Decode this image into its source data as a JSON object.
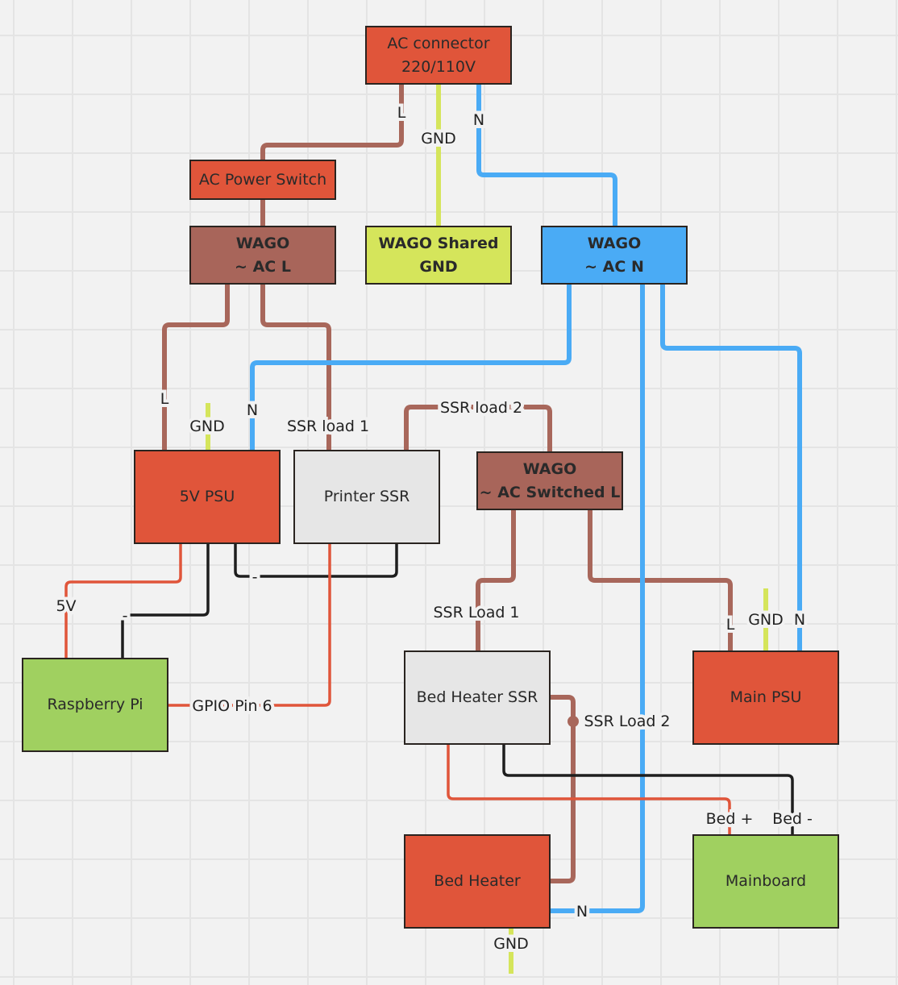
{
  "colors": {
    "red": "#e0553a",
    "brown": "#a8675b",
    "yellow": "#d5e55b",
    "blue": "#4aabf5",
    "green": "#a0d060",
    "grey": "#e6e6e6",
    "black": "#1e1e1e"
  },
  "nodes": {
    "ac_connector": "AC connector\n220/110V",
    "ac_power_switch": "AC Power Switch",
    "wago_ac_l": "WAGO\n~ AC L",
    "wago_shared_gnd": "WAGO Shared\nGND",
    "wago_ac_n": "WAGO\n~ AC N",
    "psu_5v": "5V PSU",
    "printer_ssr": "Printer SSR",
    "wago_switched_l": "WAGO\n~ AC Switched L",
    "raspberry_pi": "Raspberry Pi",
    "bed_heater_ssr": "Bed Heater SSR",
    "main_psu": "Main PSU",
    "bed_heater": "Bed Heater",
    "mainboard": "Mainboard"
  },
  "wire_labels": {
    "ac_l": "L",
    "ac_gnd": "GND",
    "ac_n": "N",
    "psu5_l": "L",
    "psu5_gnd": "GND",
    "psu5_n": "N",
    "ssr_load1": "SSR load 1",
    "ssr_load2": "SSR load 2",
    "bed_ssr_load1": "SSR Load 1",
    "bed_ssr_load2": "SSR Load 2",
    "main_l": "L",
    "main_gnd": "GND",
    "main_n": "N",
    "rpi_5v": "5V",
    "rpi_minus": "-",
    "ssr_minus": "-",
    "gpio": "GPIO Pin 6",
    "bed_plus": "Bed +",
    "bed_minus": "Bed -",
    "heater_n": "N",
    "heater_gnd": "GND"
  }
}
